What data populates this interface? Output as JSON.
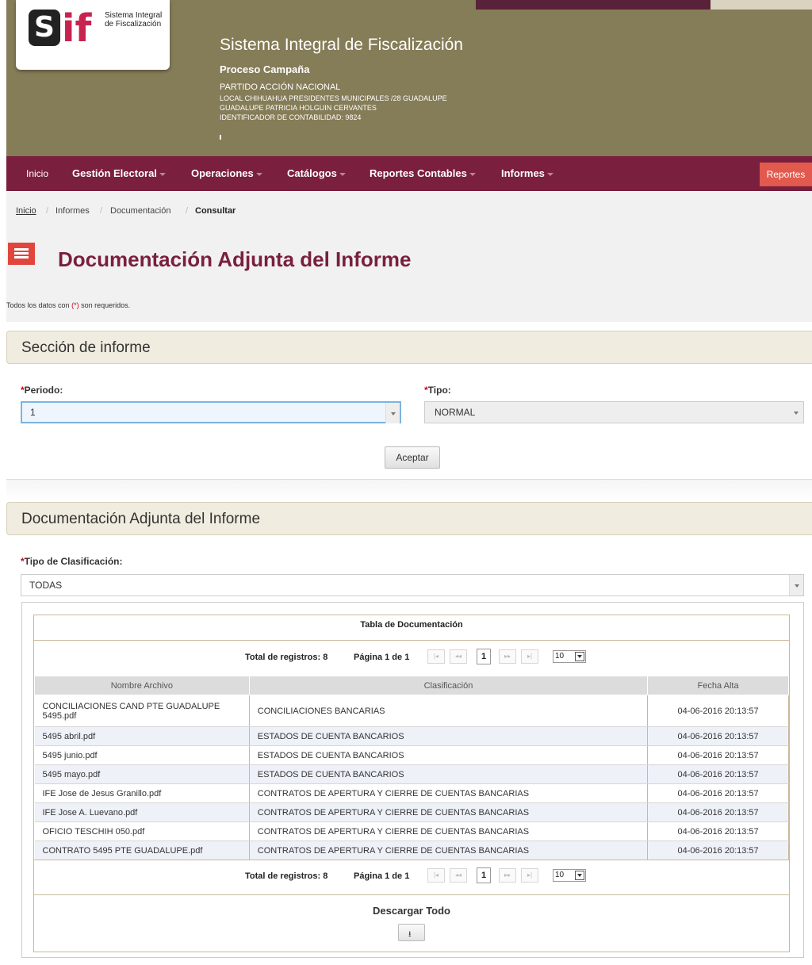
{
  "header": {
    "logo_s": "S",
    "logo_if": "if",
    "logo_text": "Sistema Integral de Fiscalización",
    "title": "Sistema Integral de Fiscalización",
    "process": "Proceso Campaña",
    "party": "PARTIDO ACCIÓN NACIONAL",
    "line1": "LOCAL CHIHUAHUA PRESIDENTES MUNICIPALES /28 GUADALUPE",
    "line2": "GUADALUPE PATRICIA HOLGUIN CERVANTES",
    "line3": "IDENTIFICADOR DE CONTABILIDAD: 9824"
  },
  "nav": {
    "items": [
      {
        "label": "Inicio"
      },
      {
        "label": "Gestión Electoral"
      },
      {
        "label": "Operaciones"
      },
      {
        "label": "Catálogos"
      },
      {
        "label": "Reportes Contables"
      },
      {
        "label": "Informes"
      }
    ],
    "reportes": "Reportes"
  },
  "breadcrumb": [
    "Inicio",
    "Informes",
    "Documentación",
    "Consultar"
  ],
  "page": {
    "title": "Documentación Adjunta del Informe",
    "required_note_pre": "Todos los datos con",
    "required_note_ast": "(*)",
    "required_note_post": "son requeridos."
  },
  "section1": {
    "title": "Sección de informe",
    "periodo_label": "Periodo:",
    "periodo_value": "1",
    "tipo_label": "Tipo:",
    "tipo_value": "NORMAL",
    "aceptar": "Aceptar"
  },
  "section2": {
    "title": "Documentación Adjunta del Informe",
    "clasif_label": "Tipo de Clasificación:",
    "clasif_value": "TODAS"
  },
  "table": {
    "caption": "Tabla de Documentación",
    "total": "Total de registros: 8",
    "page": "Página 1 de 1",
    "current_page": "1",
    "page_size": "10",
    "columns": [
      "Nombre Archivo",
      "Clasificación",
      "Fecha Alta"
    ],
    "rows": [
      [
        "CONCILIACIONES CAND PTE GUADALUPE 5495.pdf",
        "CONCILIACIONES BANCARIAS",
        "04-06-2016 20:13:57"
      ],
      [
        "5495 abril.pdf",
        "ESTADOS DE CUENTA BANCARIOS",
        "04-06-2016 20:13:57"
      ],
      [
        "5495 junio.pdf",
        "ESTADOS DE CUENTA BANCARIOS",
        "04-06-2016 20:13:57"
      ],
      [
        "5495 mayo.pdf",
        "ESTADOS DE CUENTA BANCARIOS",
        "04-06-2016 20:13:57"
      ],
      [
        "IFE Jose de Jesus Granillo.pdf",
        "CONTRATOS DE APERTURA Y CIERRE DE CUENTAS BANCARIAS",
        "04-06-2016 20:13:57"
      ],
      [
        "IFE Jose A. Luevano.pdf",
        "CONTRATOS DE APERTURA Y CIERRE DE CUENTAS BANCARIAS",
        "04-06-2016 20:13:57"
      ],
      [
        "OFICIO TESCHIH 050.pdf",
        "CONTRATOS DE APERTURA Y CIERRE DE CUENTAS BANCARIAS",
        "04-06-2016 20:13:57"
      ],
      [
        "CONTRATO 5495 PTE GUADALUPE.pdf",
        "CONTRATOS DE APERTURA Y CIERRE DE CUENTAS BANCARIAS",
        "04-06-2016 20:13:57"
      ]
    ],
    "download_all": "Descargar Todo"
  },
  "colors": {
    "header_bg": "#857c58",
    "nav_bg": "#7a1f3d",
    "title_color": "#7a1f3d",
    "reportes_bg": "#e2594d",
    "menu_icon": "#e2453c",
    "section_bg": "#f1ece0"
  },
  "icons": [
    "menu-icon",
    "caret-icon",
    "download-icon",
    "first-page-icon",
    "prev-page-icon",
    "next-page-icon",
    "last-page-icon"
  ]
}
